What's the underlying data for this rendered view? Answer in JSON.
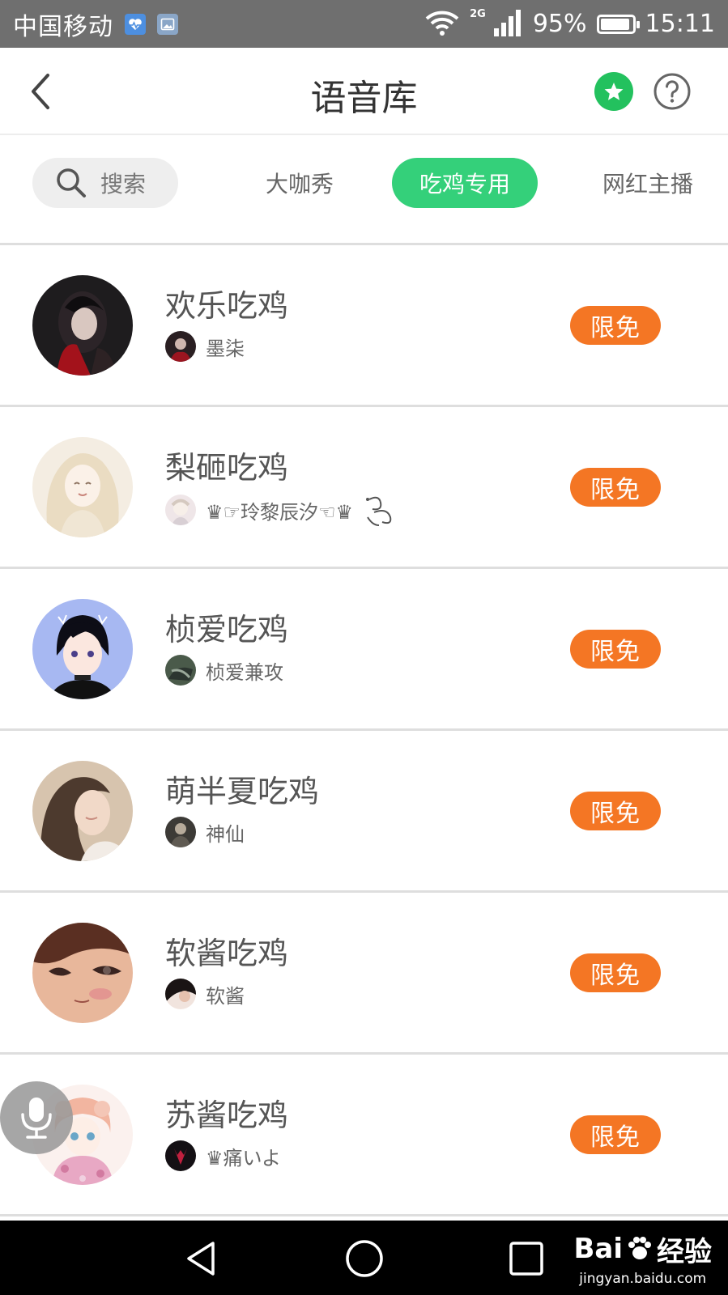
{
  "status_bar": {
    "carrier": "中国移动",
    "network": "2G",
    "battery_text": "95%",
    "battery_level": 0.95,
    "time": "15:11",
    "icons": [
      "health-icon",
      "gallery-icon",
      "wifi-icon",
      "signal-icon",
      "battery-icon"
    ]
  },
  "header": {
    "title": "语音库",
    "back_icon": "chevron-left-icon",
    "favorite_icon": "star-icon",
    "help_icon": "question-icon",
    "accent": "#23c15e"
  },
  "tabs": {
    "search_label": "搜索",
    "items": [
      {
        "label": "大咖秀",
        "active": false
      },
      {
        "label": "吃鸡专用",
        "active": true
      },
      {
        "label": "网红主播",
        "active": false
      }
    ],
    "active_color": "#34d07a"
  },
  "list": {
    "badge_color": "#f47624",
    "items": [
      {
        "title": "欢乐吃鸡",
        "author": "墨柒",
        "badge": "限免"
      },
      {
        "title": "梨砸吃鸡",
        "author": "♛☞玲黎辰汐☜♛",
        "badge": "限免"
      },
      {
        "title": "桢爱吃鸡",
        "author": "桢爱兼攻",
        "badge": "限免"
      },
      {
        "title": "萌半夏吃鸡",
        "author": "神仙",
        "badge": "限免"
      },
      {
        "title": "软酱吃鸡",
        "author": "软酱",
        "badge": "限免"
      },
      {
        "title": "苏酱吃鸡",
        "author": "♛痛いよ",
        "badge": "限免"
      }
    ]
  },
  "floating": {
    "mic_icon": "microphone-icon"
  },
  "nav_bar": {
    "back_icon": "triangle-back-icon",
    "home_icon": "circle-home-icon",
    "recent_icon": "square-recent-icon"
  },
  "watermark": {
    "brand": "Bai",
    "brand_suffix": "经验",
    "url": "jingyan.baidu.com"
  }
}
